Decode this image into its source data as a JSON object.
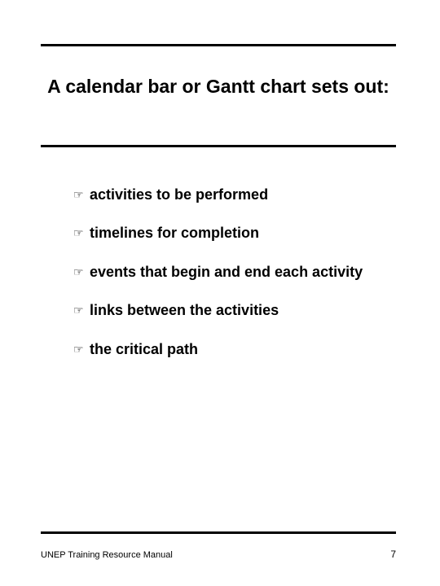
{
  "title": "A calendar bar or Gantt chart sets out:",
  "bullets": [
    "activities to be performed",
    "timelines for completion",
    "events that begin and end each activity",
    "links between the activities",
    "the critical path"
  ],
  "footer": {
    "source": "UNEP Training Resource Manual",
    "page_number": "7"
  },
  "bullet_glyph": "☞"
}
